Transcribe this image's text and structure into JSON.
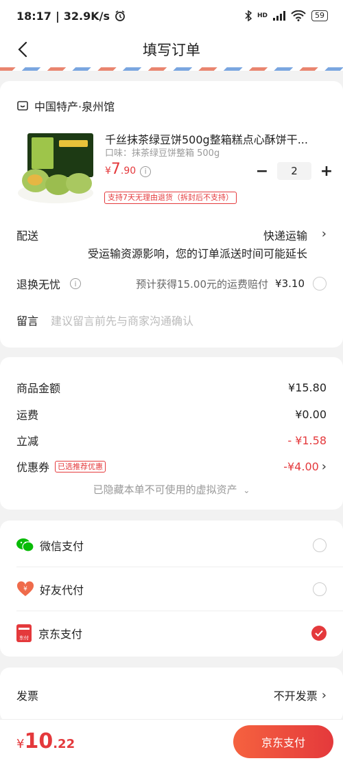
{
  "status_bar": {
    "time": "18:17",
    "speed": "32.9K/s",
    "battery": "59",
    "network": "HD"
  },
  "nav": {
    "title": "填写订单"
  },
  "shop": {
    "name": "中国特产·泉州馆"
  },
  "product": {
    "title": "千丝抹茶绿豆饼500g整箱糕点心酥饼干...",
    "spec": "口味：抹茶绿豆饼整箱 500g",
    "currency": "¥",
    "price_int": "7",
    "price_dec": ".90",
    "quantity": "2",
    "minus": "−",
    "plus": "+",
    "return_badge": "支持7天无理由退货（拆封后不支持）"
  },
  "delivery": {
    "label": "配送",
    "method": "快递运输",
    "notice": "受运输资源影响，您的订单派送时间可能延长"
  },
  "insurance": {
    "label": "退换无忧",
    "desc_prefix": "预计获得",
    "amount": "15.00",
    "desc_suffix": "元的运费赔付",
    "price": "¥3.10"
  },
  "note": {
    "label": "留言",
    "placeholder": "建议留言前先与商家沟通确认"
  },
  "summary": {
    "goods_label": "商品金额",
    "goods_value": "¥15.80",
    "shipping_label": "运费",
    "shipping_value": "¥0.00",
    "discount_label": "立减",
    "discount_value": "- ¥1.58",
    "coupon_label": "优惠券",
    "coupon_badge": "已选推荐优惠",
    "coupon_value": "-¥4.00",
    "hidden_assets": "已隐藏本单不可使用的虚拟资产"
  },
  "payment": {
    "wechat": "微信支付",
    "friend": "好友代付",
    "jd": "京东支付",
    "jd_icon_text": "东付",
    "selected": "jd"
  },
  "invoice": {
    "label": "发票",
    "value": "不开发票"
  },
  "footer": {
    "currency": "¥",
    "total_int": "10",
    "total_dec": ".22",
    "submit": "京东支付"
  },
  "colors": {
    "accent": "#e4393c",
    "wechat": "#09bb07",
    "background": "#f2f2f2"
  }
}
